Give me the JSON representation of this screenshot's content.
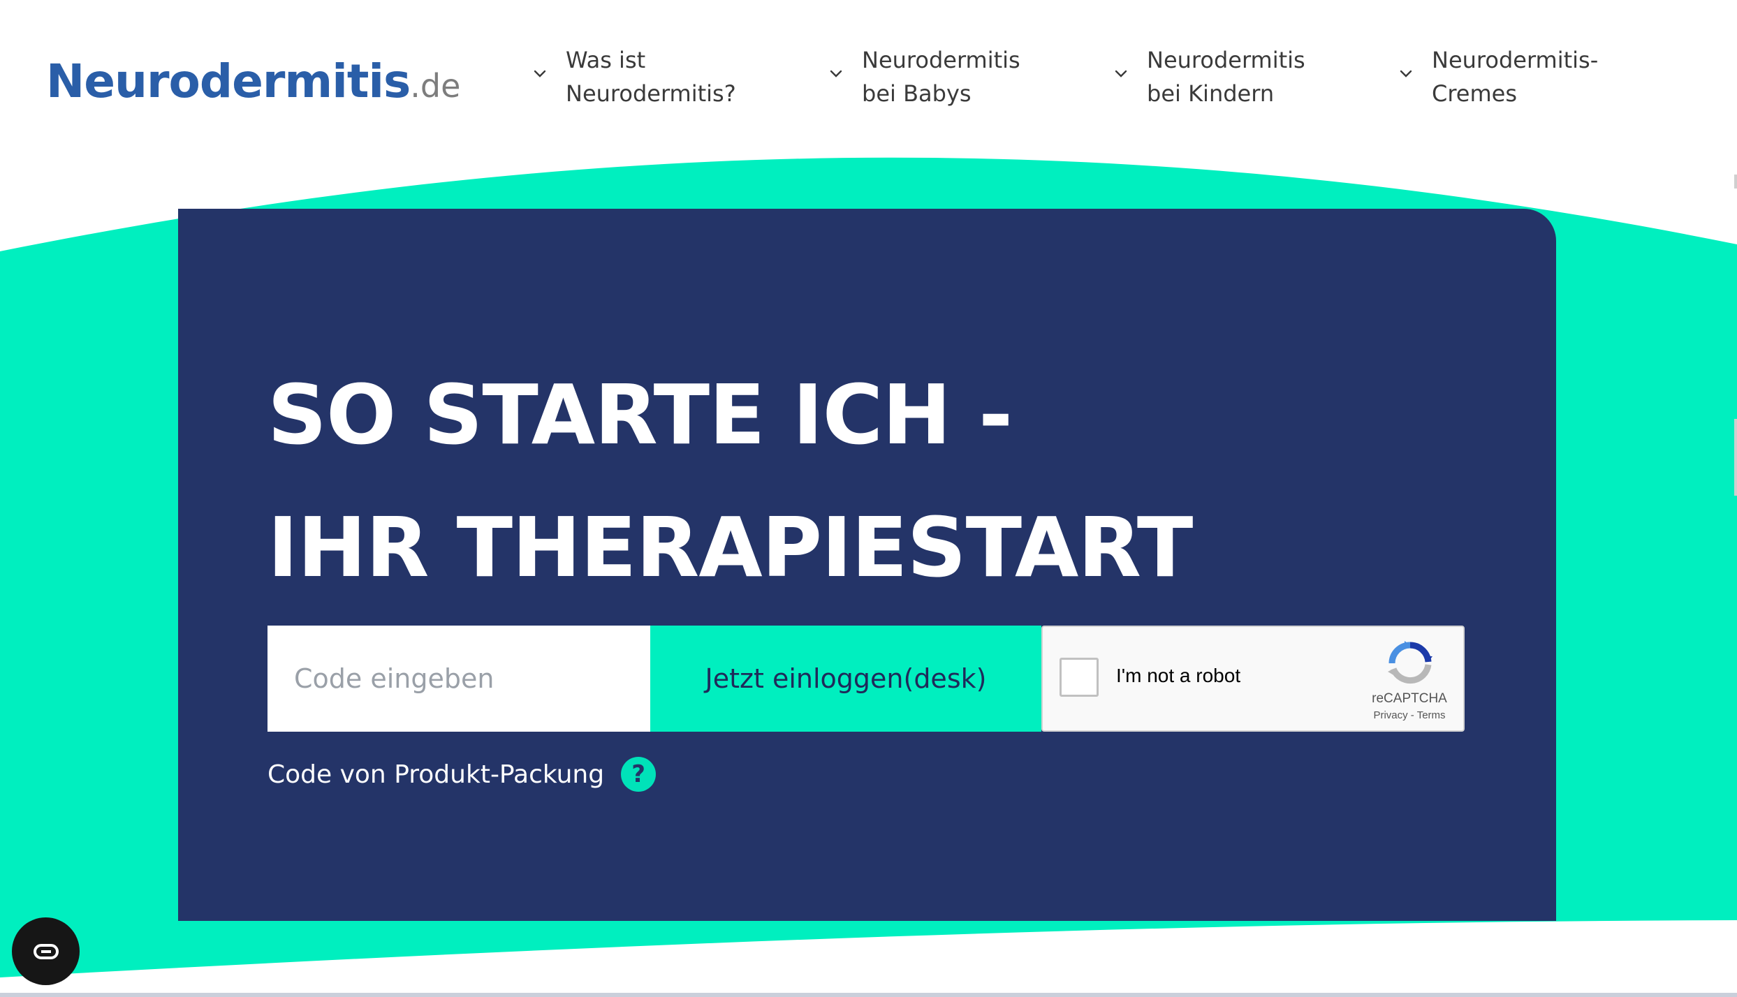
{
  "brand": {
    "logo_main": "Neurodermitis",
    "logo_tld": ".de"
  },
  "nav": {
    "items": [
      {
        "label_line1": "Was ist",
        "label_line2": "Neurodermitis?"
      },
      {
        "label_line1": "Neurodermitis",
        "label_line2": "bei Babys"
      },
      {
        "label_line1": "Neurodermitis",
        "label_line2": "bei Kindern"
      },
      {
        "label_line1": "Neurodermitis-",
        "label_line2": "Cremes"
      }
    ]
  },
  "hero": {
    "title_line1": "SO STARTE ICH -",
    "title_line2": "IHR THERAPIESTART",
    "code_placeholder": "Code eingeben",
    "login_label": "Jetzt einloggen(desk)",
    "hint_text": "Code von Produkt-Packung",
    "help_glyph": "?"
  },
  "recaptcha": {
    "label": "I'm not a robot",
    "brand": "reCAPTCHA",
    "privacy": "Privacy",
    "separator": " - ",
    "terms": "Terms"
  },
  "colors": {
    "navy": "#243468",
    "mint": "#00efbf",
    "logo_blue": "#2a5ea8"
  },
  "icons": {
    "nav_chevron": "chevron-down-icon",
    "help": "question-circle-icon",
    "recaptcha": "recaptcha-logo-icon",
    "widget": "accessibility-toggle-icon"
  }
}
